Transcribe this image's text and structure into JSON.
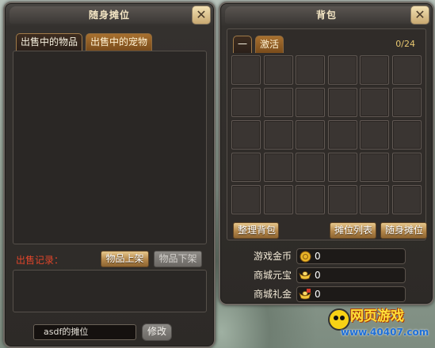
{
  "stall": {
    "title": "随身摊位",
    "close_label": "✕",
    "tabs": [
      {
        "label": "出售中的物品",
        "active": true
      },
      {
        "label": "出售中的宠物",
        "active": false
      }
    ],
    "record_label": "出售记录：",
    "list_item_button": "物品上架",
    "delist_item_button": "物品下架",
    "stall_name_value": "asdf的摊位",
    "modify_button": "修改"
  },
  "bag": {
    "title": "背包",
    "close_label": "✕",
    "tabs": [
      {
        "label": "一",
        "active": true
      },
      {
        "label": "激活",
        "active": false
      }
    ],
    "capacity": "0/24",
    "grid": {
      "rows": 5,
      "cols": 6
    },
    "sort_button": "整理背包",
    "stall_list_button": "摊位列表",
    "portable_stall_button": "随身摊位",
    "currencies": [
      {
        "label": "游戏金币",
        "value": "0",
        "icon": "gold-coin-icon"
      },
      {
        "label": "商城元宝",
        "value": "0",
        "icon": "ingot-icon"
      },
      {
        "label": "商城礼金",
        "value": "0",
        "icon": "gift-ingot-icon"
      }
    ]
  },
  "watermark": {
    "name": "网页游戏",
    "url": "www.40407.com"
  },
  "colors": {
    "panel": "#2d2a27",
    "gold_button": "#b38649",
    "tab_orange": "#a7702f",
    "title_text": "#f4e6c4",
    "record_text": "#e0452a"
  }
}
